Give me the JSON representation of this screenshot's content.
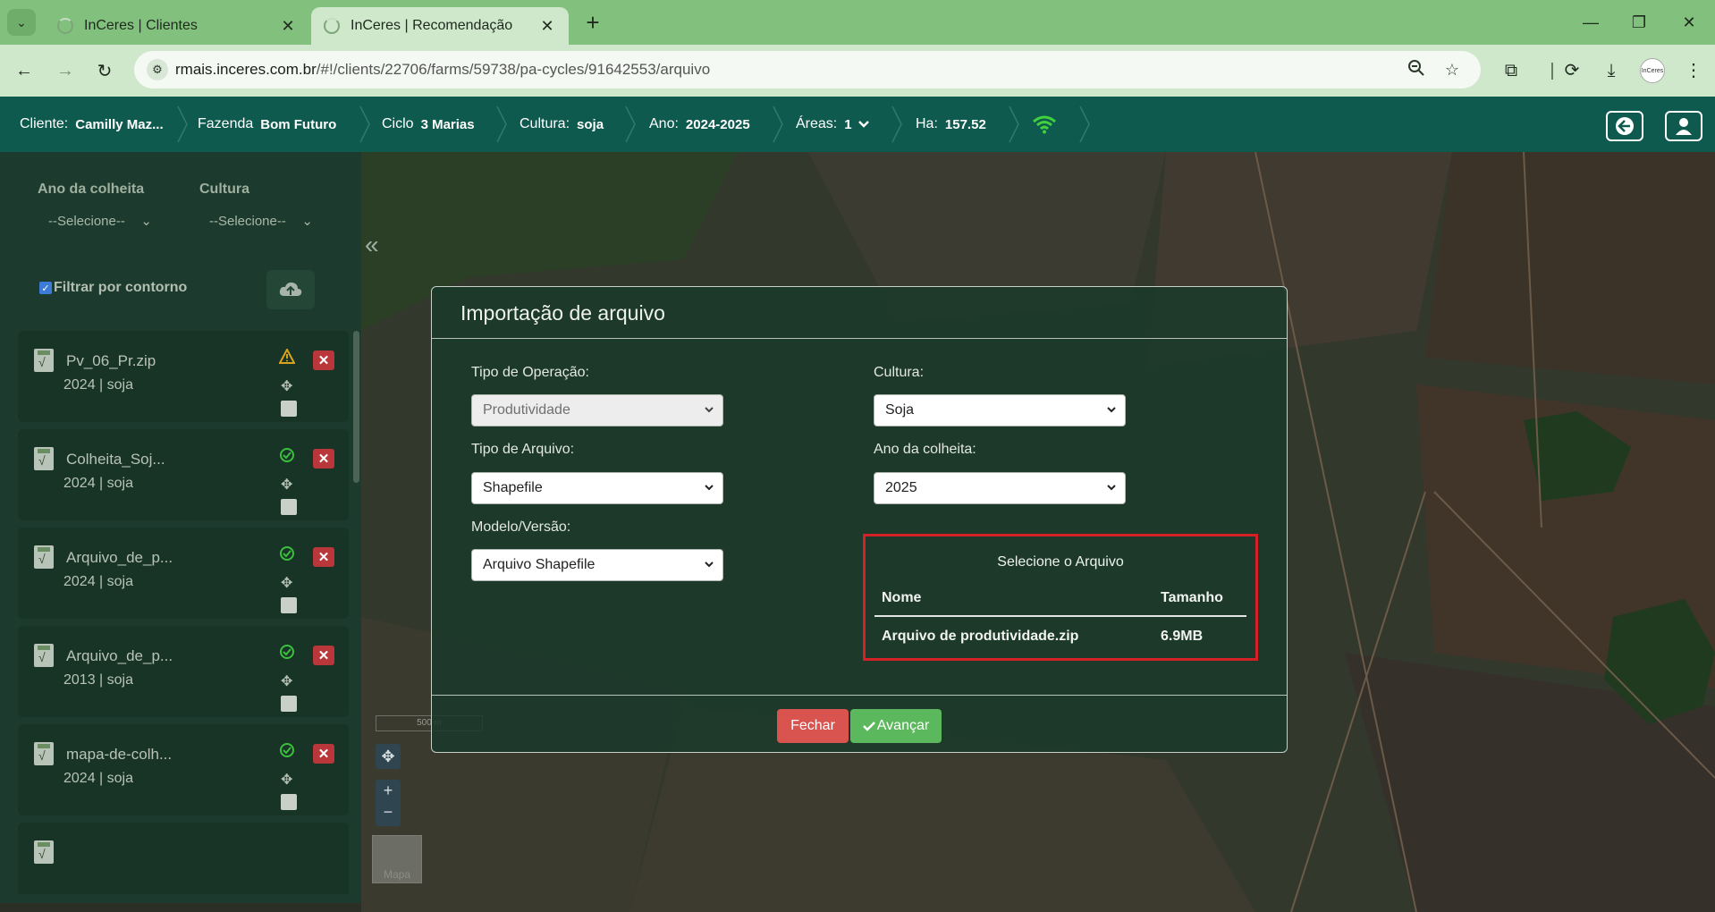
{
  "browser": {
    "tabs": [
      {
        "title": "InCeres | Clientes"
      },
      {
        "title": "InCeres | Recomendação"
      }
    ],
    "url_host": "rmais.inceres.com.br",
    "url_path": "/#!/clients/22706/farms/59738/pa-cycles/91642553/arquivo",
    "profile_label": "InCeres"
  },
  "header": {
    "client": {
      "label": "Cliente:",
      "value": "Camilly Maz..."
    },
    "farm": {
      "label": "Fazenda",
      "value": "Bom Futuro"
    },
    "cycle": {
      "label": "Ciclo",
      "value": "3 Marias"
    },
    "crop": {
      "label": "Cultura:",
      "value": "soja"
    },
    "year": {
      "label": "Ano:",
      "value": "2024-2025"
    },
    "areas": {
      "label": "Áreas:",
      "value": "1"
    },
    "ha": {
      "label": "Ha:",
      "value": "157.52"
    }
  },
  "sidebar": {
    "harvest_year_label": "Ano da colheita",
    "crop_label": "Cultura",
    "select_placeholder": "--Selecione--",
    "contour_filter_label": "Filtrar por contorno",
    "files": [
      {
        "name": "Pv_06_Pr.zip",
        "meta": "2024 | soja",
        "status": "warning"
      },
      {
        "name": "Colheita_Soj...",
        "meta": "2024 | soja",
        "status": "ok"
      },
      {
        "name": "Arquivo_de_p...",
        "meta": "2024 | soja",
        "status": "ok"
      },
      {
        "name": "Arquivo_de_p...",
        "meta": "2013 | soja",
        "status": "ok"
      },
      {
        "name": "mapa-de-colh...",
        "meta": "2024 | soja",
        "status": "ok"
      }
    ]
  },
  "map": {
    "scale_label": "500 m",
    "basemap_label": "Mapa"
  },
  "modal": {
    "title": "Importação de arquivo",
    "operation_type": {
      "label": "Tipo de Operação:",
      "value": "Produtividade"
    },
    "file_type": {
      "label": "Tipo de Arquivo:",
      "value": "Shapefile"
    },
    "model_version": {
      "label": "Modelo/Versão:",
      "value": "Arquivo Shapefile"
    },
    "crop": {
      "label": "Cultura:",
      "value": "Soja"
    },
    "harvest_year": {
      "label": "Ano da colheita:",
      "value": "2025"
    },
    "file_select": {
      "title": "Selecione o Arquivo",
      "col_name": "Nome",
      "col_size": "Tamanho",
      "rows": [
        {
          "name": "Arquivo de produtividade.zip",
          "size": "6.9MB"
        }
      ]
    },
    "close_label": "Fechar",
    "next_label": "Avançar"
  },
  "colors": {
    "app_header": "#0f5a4f",
    "sidebar": "#1c3a2d",
    "danger": "#d9534f",
    "success": "#5cb85c",
    "highlight_box": "#d62028"
  }
}
